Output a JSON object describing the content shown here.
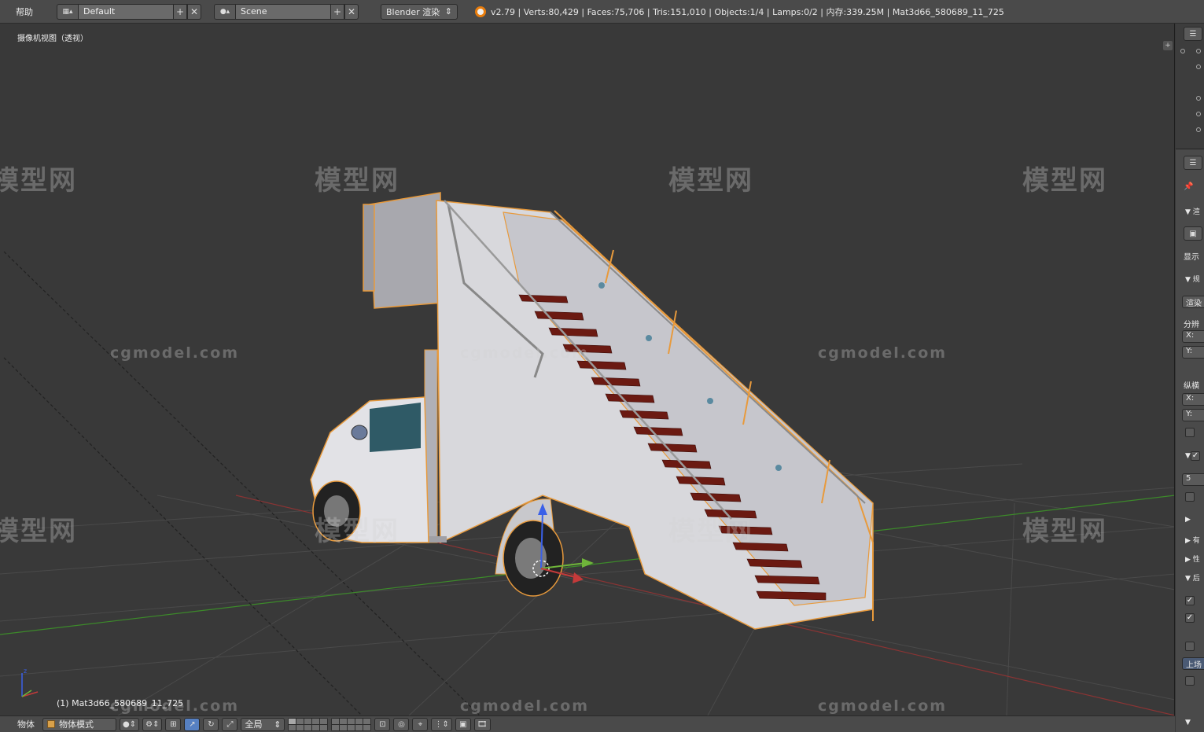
{
  "header": {
    "help_menu": "帮助",
    "screen_layout": "Default",
    "scene": "Scene",
    "render_engine": "Blender 渲染",
    "stats": "v2.79 | Verts:80,429 | Faces:75,706 | Tris:151,010 | Objects:1/4 | Lamps:0/2 | 内存:339.25M | Mat3d66_580689_11_725",
    "add_icon": "plus-icon",
    "close_icon": "close-icon"
  },
  "viewport": {
    "view_title": "摄像机视图（透视）",
    "active_object": "(1) Mat3d66_580689_11_725",
    "plus_glyph": "+"
  },
  "watermarks": {
    "logo_text": "模型网",
    "site_text": "cgmodel.com"
  },
  "footer": {
    "object_menu": "物体",
    "interaction_mode": "物体模式",
    "transform_orientation": "全局",
    "layers_active": [
      0
    ],
    "layers_count": 20
  },
  "properties": {
    "truncated_rows": [
      "渲",
      "显示",
      "规",
      "渲染",
      "分辨",
      "X:",
      "Y:",
      "X:",
      "Y:",
      "纵横",
      "5",
      "有",
      "性",
      "后",
      "上场"
    ],
    "check_glyph": "✓"
  },
  "colors": {
    "selection_outline": "#e89a3c",
    "x_axis": "#c43a3a",
    "y_axis": "#6fb53a",
    "z_axis": "#3a60e8",
    "active_button": "#5680c2"
  }
}
